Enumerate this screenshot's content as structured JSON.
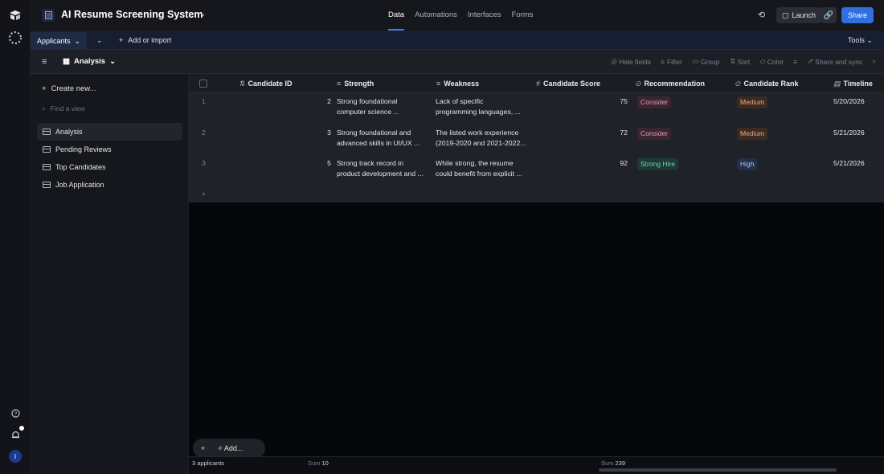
{
  "topbar": {
    "base_title": "AI Resume Screening System",
    "tabs": [
      "Data",
      "Automations",
      "Interfaces",
      "Forms"
    ],
    "active_tab": "Data",
    "launch_label": "Launch",
    "share_label": "Share"
  },
  "tablebar": {
    "table_name": "Applicants",
    "add_import_label": "Add or import",
    "tools_label": "Tools"
  },
  "viewbar": {
    "view_name": "Analysis",
    "actions": [
      "Hide fields",
      "Filter",
      "Group",
      "Sort",
      "Color",
      "Share and sync"
    ]
  },
  "sidebar": {
    "create_label": "Create new...",
    "find_placeholder": "Find a view",
    "views": [
      "Analysis",
      "Pending Reviews",
      "Top Candidates",
      "Job Application"
    ]
  },
  "grid": {
    "columns": [
      "Candidate ID",
      "Strength",
      "Weakness",
      "Candidate Score",
      "Recommendation",
      "Candidate Rank",
      "Timeline"
    ],
    "rows": [
      {
        "row": "1",
        "id": "2",
        "strength_1": "Strong foundational",
        "strength_2": "computer science ...",
        "weakness_1": "Lack of specific",
        "weakness_2": "programming languages, ...",
        "score": "75",
        "recommendation": "Consider",
        "rank": "Medium",
        "timeline": "5/20/2026"
      },
      {
        "row": "2",
        "id": "3",
        "strength_1": "Strong foundational and",
        "strength_2": "advanced skills in UI/UX ...",
        "weakness_1": "The listed work experience",
        "weakness_2": "(2019-2020 and 2021-2022...",
        "score": "72",
        "recommendation": "Consider",
        "rank": "Medium",
        "timeline": "5/21/2026"
      },
      {
        "row": "3",
        "id": "5",
        "strength_1": "Strong track record in",
        "strength_2": "product development and ...",
        "weakness_1": "While strong, the resume",
        "weakness_2": "could benefit from explicit ...",
        "score": "92",
        "recommendation": "Strong Hire",
        "rank": "High",
        "timeline": "5/21/2026"
      }
    ]
  },
  "footer": {
    "count_label": "3 applicants",
    "sum_label": "Sum",
    "sum_id": "10",
    "sum_score": "239"
  },
  "add_button_label": "Add...",
  "rail": {
    "avatar_initial": "I"
  }
}
